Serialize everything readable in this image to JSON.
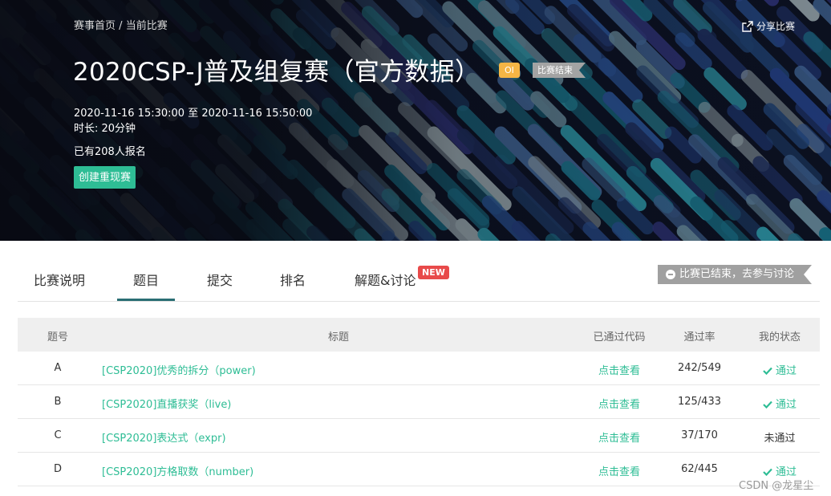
{
  "breadcrumb": {
    "home": "赛事首页",
    "sep": "/",
    "current": "当前比赛"
  },
  "share_label": "分享比赛",
  "contest": {
    "title": "2020CSP-J普及组复赛（官方数据）",
    "badge_type": "OI",
    "badge_status": "比赛结束",
    "time": "2020-11-16 15:30:00 至 2020-11-16 15:50:00",
    "duration": "时长: 20分钟",
    "signups": "已有208人报名",
    "create_button": "创建重现赛"
  },
  "tabs": [
    {
      "label": "比赛说明"
    },
    {
      "label": "题目"
    },
    {
      "label": "提交"
    },
    {
      "label": "排名"
    },
    {
      "label": "解题&讨论"
    }
  ],
  "active_tab": "题目",
  "new_badge": "NEW",
  "ended_banner": "比赛已结束，去参与讨论",
  "table": {
    "headers": {
      "id": "题号",
      "title": "标题",
      "code": "已通过代码",
      "rate": "通过率",
      "status": "我的状态"
    },
    "rows": [
      {
        "id": "A",
        "title": "[CSP2020]优秀的拆分（power)",
        "code": "点击查看",
        "rate": "242/549",
        "status": "通过",
        "passed": true
      },
      {
        "id": "B",
        "title": "[CSP2020]直播获奖（live)",
        "code": "点击查看",
        "rate": "125/433",
        "status": "通过",
        "passed": true
      },
      {
        "id": "C",
        "title": "[CSP2020]表达式（expr)",
        "code": "点击查看",
        "rate": "37/170",
        "status": "未通过",
        "passed": false
      },
      {
        "id": "D",
        "title": "[CSP2020]方格取数（number)",
        "code": "点击查看",
        "rate": "62/445",
        "status": "通过",
        "passed": true
      }
    ]
  },
  "watermark": "CSDN @龙星尘",
  "colors": {
    "accent": "#2ebd95",
    "tab_underline": "#2a6e74",
    "oi_badge": "#f5b545",
    "new_badge": "#e84a4a"
  }
}
